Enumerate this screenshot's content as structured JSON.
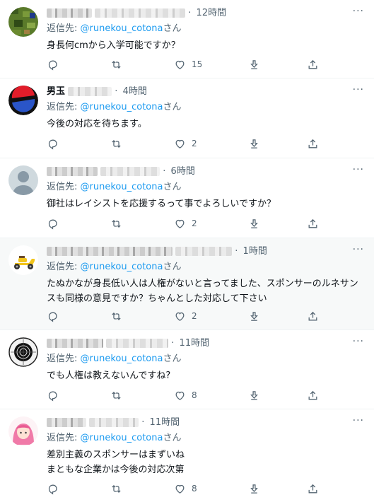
{
  "reply_to_label": "返信先: ",
  "reply_to_suffix": "さん",
  "tweets": [
    {
      "handle_pre": "",
      "time": "12時間",
      "reply_handle": "@runekou_cotona",
      "text": [
        "身長何cmから入学可能ですか？"
      ],
      "likes": "15",
      "avatar": "pixel-game-avatar"
    },
    {
      "handle_pre": "男玉",
      "time": "4時間",
      "reply_handle": "@runekou_cotona",
      "text": [
        "今後の対応を待ちます。"
      ],
      "likes": "2",
      "avatar": "red-blue-ball-avatar"
    },
    {
      "handle_pre": "",
      "time": "6時間",
      "reply_handle": "@runekou_cotona",
      "text": [
        "御社はレイシストを応援するって事でよろしいですか？"
      ],
      "likes": "2",
      "avatar": "default-person-avatar"
    },
    {
      "handle_pre": "",
      "time": "1時間",
      "reply_handle": "@runekou_cotona",
      "text": [
        "たぬかなが身長低い人は人権がないと言ってました、スポンサーのルネサン",
        "スも同様の意見ですか？ちゃんとした対応して下さい"
      ],
      "likes": "2",
      "avatar": "yellow-scooter-avatar"
    },
    {
      "handle_pre": "",
      "time": "11時間",
      "reply_handle": "@runekou_cotona",
      "text": [
        "でも人権は教えないんですね?"
      ],
      "likes": "8",
      "avatar": "target-avatar"
    },
    {
      "handle_pre": "",
      "time": "11時間",
      "reply_handle": "@runekou_cotona",
      "text": [
        "差別主義のスポンサーはまずいね",
        "まともな企業かは今後の対応次第"
      ],
      "likes": "8",
      "avatar": "pink-hair-character-avatar"
    }
  ],
  "colors": {
    "accent": "#1d9bf0",
    "muted": "#536471",
    "text": "#0f1419",
    "highlight_bg": "#f7f9f9"
  },
  "icons": [
    "reply-icon",
    "retweet-icon",
    "like-icon",
    "download-icon",
    "share-icon",
    "more-icon"
  ]
}
